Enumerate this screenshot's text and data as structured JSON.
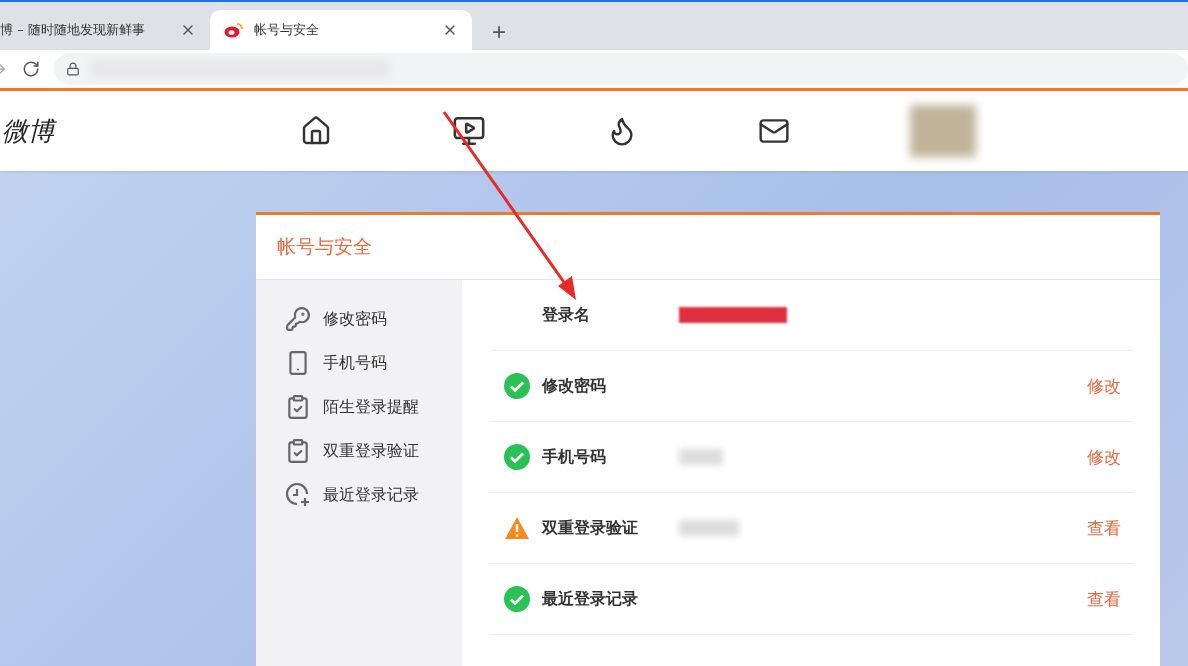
{
  "browser": {
    "tabs": [
      {
        "title": "博 – 随时随地发现新鲜事",
        "selected": false
      },
      {
        "title": "帐号与安全",
        "selected": true
      }
    ],
    "new_tab": "+"
  },
  "header": {
    "logo": "微博",
    "nav": [
      {
        "kind": "home"
      },
      {
        "kind": "video"
      },
      {
        "kind": "hot"
      },
      {
        "kind": "mail"
      }
    ]
  },
  "panel": {
    "title": "帐号与安全",
    "sidebar": [
      {
        "label": "修改密码",
        "kind": "key"
      },
      {
        "label": "手机号码",
        "kind": "phone"
      },
      {
        "label": "陌生登录提醒",
        "kind": "check"
      },
      {
        "label": "双重登录验证",
        "kind": "check"
      },
      {
        "label": "最近登录记录",
        "kind": "history"
      }
    ],
    "login_label": "登录名",
    "rows": [
      {
        "label": "修改密码",
        "kind": "ok",
        "action": "修改",
        "value_hidden": false
      },
      {
        "label": "手机号码",
        "kind": "ok",
        "action": "修改",
        "value_hidden": true
      },
      {
        "label": "双重登录验证",
        "kind": "warning",
        "action": "查看",
        "value_hidden": true
      },
      {
        "label": "最近登录记录",
        "kind": "ok",
        "action": "查看",
        "value_hidden": false
      }
    ]
  }
}
